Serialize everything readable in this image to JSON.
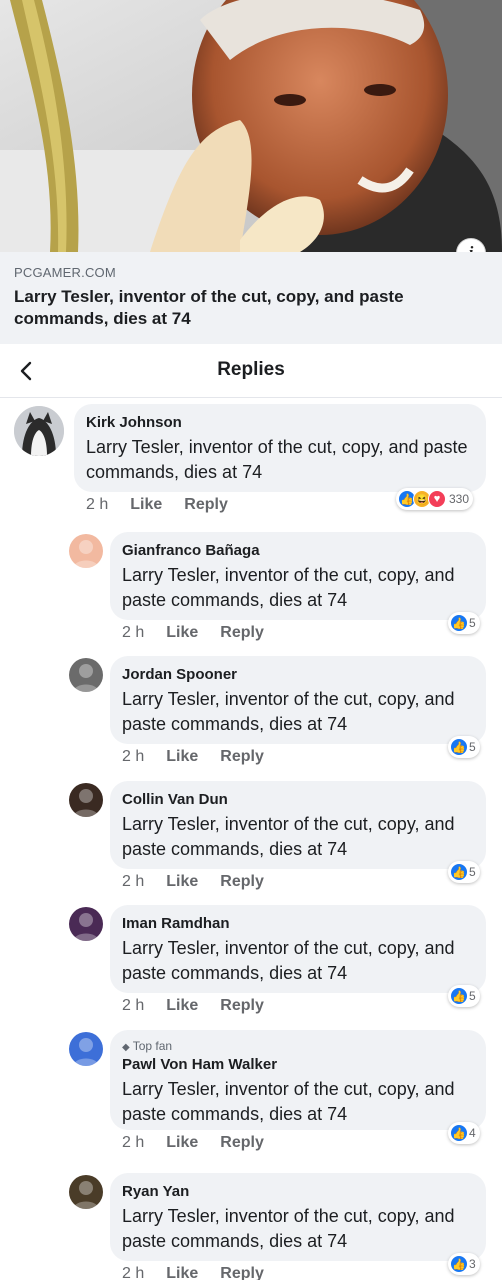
{
  "link_preview": {
    "domain": "PCGAMER.COM",
    "title": "Larry Tesler, inventor of the cut, copy, and paste commands, dies at 74",
    "info_icon": "info-icon"
  },
  "header": {
    "title": "Replies",
    "back_icon": "chevron-left-icon"
  },
  "main_comment": {
    "author": "Kirk Johnson",
    "text": "Larry Tesler, inventor of the cut, copy, and paste commands, dies at 74",
    "time": "2 h",
    "like_label": "Like",
    "reply_label": "Reply",
    "reactions": [
      "like",
      "haha",
      "love"
    ],
    "reaction_count": "330"
  },
  "replies": [
    {
      "author": "Gianfranco Bañaga",
      "badge": "",
      "text": "Larry Tesler, inventor of the cut, copy, and paste commands, dies at 74",
      "time": "2 h",
      "like_label": "Like",
      "reply_label": "Reply",
      "reaction_count": "5",
      "avatar_color": "#f2b9a0"
    },
    {
      "author": "Jordan Spooner",
      "badge": "",
      "text": "Larry Tesler, inventor of the cut, copy, and paste commands, dies at 74",
      "time": "2 h",
      "like_label": "Like",
      "reply_label": "Reply",
      "reaction_count": "5",
      "avatar_color": "#6b6b6b"
    },
    {
      "author": "Collin Van Dun",
      "badge": "",
      "text": "Larry Tesler, inventor of the cut, copy, and paste commands, dies at 74",
      "time": "2 h",
      "like_label": "Like",
      "reply_label": "Reply",
      "reaction_count": "5",
      "avatar_color": "#3a2a22"
    },
    {
      "author": "Iman Ramdhan",
      "badge": "",
      "text": "Larry Tesler, inventor of the cut, copy, and paste commands, dies at 74",
      "time": "2 h",
      "like_label": "Like",
      "reply_label": "Reply",
      "reaction_count": "5",
      "avatar_color": "#4a2a55"
    },
    {
      "author": "Pawl Von Ham Walker",
      "badge": "Top fan",
      "text": "Larry Tesler, inventor of the cut, copy, and paste commands, dies at 74",
      "time": "2 h",
      "like_label": "Like",
      "reply_label": "Reply",
      "reaction_count": "4",
      "avatar_color": "#3d6fd8"
    },
    {
      "author": "Ryan Yan",
      "badge": "",
      "text": "Larry Tesler, inventor of the cut, copy, and paste commands, dies at 74",
      "time": "2 h",
      "like_label": "Like",
      "reply_label": "Reply",
      "reaction_count": "3",
      "avatar_color": "#4a3c28"
    }
  ],
  "colors": {
    "bubble": "#f0f2f5",
    "like_blue": "#1877f2",
    "secondary_text": "#65676b"
  }
}
